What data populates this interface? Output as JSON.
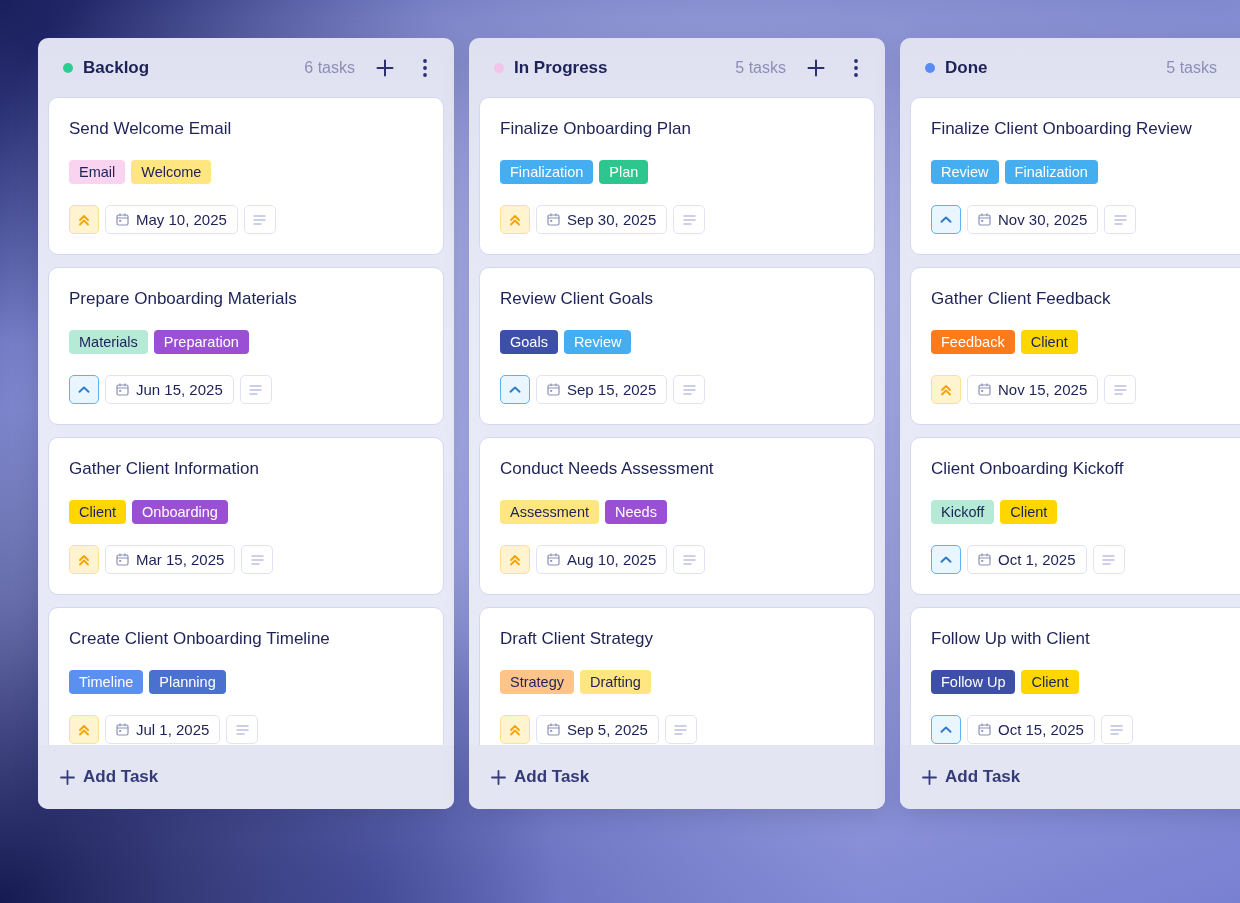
{
  "columns": [
    {
      "title": "Backlog",
      "color": "#2ecc8f",
      "count": "6 tasks",
      "actions": [
        {
          "kind": "add"
        },
        {
          "kind": "more"
        }
      ],
      "cards": [
        {
          "title": "Send Welcome Email",
          "tags": [
            {
              "label": "Email",
              "color": "#f9d3ef"
            },
            {
              "label": "Welcome",
              "color": "#ffe680"
            }
          ],
          "kind": "high",
          "date": "May 10, 2025"
        },
        {
          "title": "Prepare Onboarding Materials",
          "tags": [
            {
              "label": "Materials",
              "color": "#b5ead7"
            },
            {
              "label": "Preparation",
              "color": "#9a4fd4"
            }
          ],
          "kind": "medium",
          "date": "Jun 15, 2025"
        },
        {
          "title": "Gather Client Information",
          "tags": [
            {
              "label": "Client",
              "color": "#ffd600"
            },
            {
              "label": "Onboarding",
              "color": "#9a4fd4"
            }
          ],
          "kind": "high",
          "date": "Mar 15, 2025"
        },
        {
          "title": "Create Client Onboarding Timeline",
          "tags": [
            {
              "label": "Timeline",
              "color": "#5c8ff2"
            },
            {
              "label": "Planning",
              "color": "#4a71d0"
            }
          ],
          "kind": "high",
          "date": "Jul 1, 2025"
        }
      ],
      "add_label": "Add Task"
    },
    {
      "title": "In Progress",
      "color": "#f3c4ea",
      "count": "5 tasks",
      "actions": [
        {
          "kind": "add"
        },
        {
          "kind": "more"
        }
      ],
      "cards": [
        {
          "title": "Finalize Onboarding Plan",
          "tags": [
            {
              "label": "Finalization",
              "color": "#45aef0"
            },
            {
              "label": "Plan",
              "color": "#2cc68e"
            }
          ],
          "kind": "high",
          "date": "Sep 30, 2025"
        },
        {
          "title": "Review Client Goals",
          "tags": [
            {
              "label": "Goals",
              "color": "#3d4fa6"
            },
            {
              "label": "Review",
              "color": "#45aef0"
            }
          ],
          "kind": "medium",
          "date": "Sep 15, 2025"
        },
        {
          "title": "Conduct Needs Assessment",
          "tags": [
            {
              "label": "Assessment",
              "color": "#ffe680"
            },
            {
              "label": "Needs",
              "color": "#9a4fd4"
            }
          ],
          "kind": "high",
          "date": "Aug 10, 2025"
        },
        {
          "title": "Draft Client Strategy",
          "tags": [
            {
              "label": "Strategy",
              "color": "#ffc48a"
            },
            {
              "label": "Drafting",
              "color": "#ffe680"
            }
          ],
          "kind": "high",
          "date": "Sep 5, 2025"
        }
      ],
      "add_label": "Add Task"
    },
    {
      "title": "Done",
      "color": "#5b8cf5",
      "count": "5 tasks",
      "cards": [
        {
          "title": "Finalize Client Onboarding Review",
          "tags": [
            {
              "label": "Review",
              "color": "#45aef0"
            },
            {
              "label": "Finalization",
              "color": "#45aef0"
            }
          ],
          "kind": "medium",
          "date": "Nov 30, 2025"
        },
        {
          "title": "Gather Client Feedback",
          "tags": [
            {
              "label": "Feedback",
              "color": "#ff7a1a"
            },
            {
              "label": "Client",
              "color": "#ffd600"
            }
          ],
          "kind": "high",
          "date": "Nov 15, 2025"
        },
        {
          "title": "Client Onboarding Kickoff",
          "tags": [
            {
              "label": "Kickoff",
              "color": "#b5ead7"
            },
            {
              "label": "Client",
              "color": "#ffd600"
            }
          ],
          "kind": "medium",
          "date": "Oct 1, 2025"
        },
        {
          "title": "Follow Up with Client",
          "tags": [
            {
              "label": "Follow Up",
              "color": "#3d4fa6"
            },
            {
              "label": "Client",
              "color": "#ffd600"
            }
          ],
          "kind": "medium",
          "date": "Oct 15, 2025"
        }
      ],
      "add_label": "Add Task"
    }
  ]
}
